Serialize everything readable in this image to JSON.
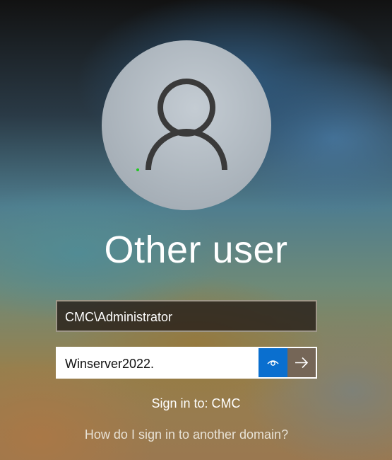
{
  "user": {
    "name": "Other user"
  },
  "fields": {
    "username_value": "CMC\\Administrator",
    "password_value": "Winserver2022."
  },
  "signin": {
    "target": "Sign in to: CMC",
    "other_domain_link": "How do I sign in to another domain?"
  },
  "icons": {
    "avatar": "person-icon",
    "reveal": "eye-icon",
    "submit": "arrow-right-icon"
  },
  "colors": {
    "reveal_button": "#0a6fcf",
    "submit_button": "#756657",
    "avatar_bg": "#b3bcc4"
  }
}
